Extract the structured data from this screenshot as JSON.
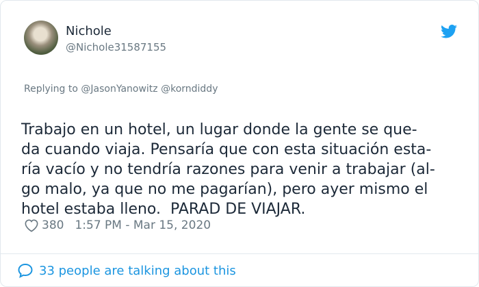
{
  "author": {
    "name": "Nichole",
    "handle": "@Nichole31587155"
  },
  "icons": {
    "brand": "twitter-bird-icon",
    "like": "heart-icon",
    "reply": "speech-bubble-icon"
  },
  "colors": {
    "accent": "#1b95e0",
    "text": "#1c2938",
    "muted": "#697882"
  },
  "tweet": {
    "replying_to": "Replying to @JasonYanowitz @korndiddy",
    "lines": [
      "Trabajo en un hotel, un lugar donde la gente se que-",
      "da cuando viaja. Pensaría que con esta situación esta-",
      "ría vacío y no tendría razones para venir a trabajar (al-",
      "go malo, ya que no me pagarían), pero ayer mismo el",
      "hotel estaba lleno.  PARAD DE VIAJAR."
    ],
    "likes": "380",
    "timestamp": "1:57 PM - Mar 15, 2020"
  },
  "conversation": {
    "label": "33 people are talking about this"
  }
}
